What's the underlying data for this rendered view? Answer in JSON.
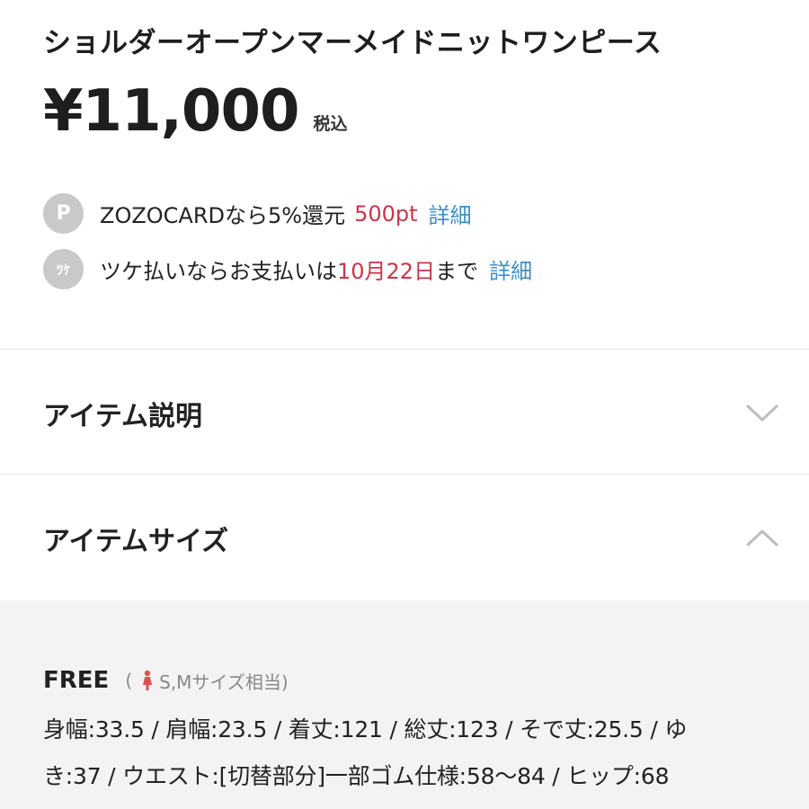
{
  "product": {
    "title": "ショルダーオープンマーメイドニットワンピース",
    "price": "¥11,000",
    "tax_label": "税込"
  },
  "point_info": {
    "badge": "P",
    "text": "ZOZOCARDなら5%還元",
    "points": "500pt",
    "link": "詳細"
  },
  "deferred_payment": {
    "badge": "ﾂｹ",
    "text_before": "ツケ払いならお支払いは",
    "date": "10月22日",
    "text_after": "まで",
    "link": "詳細"
  },
  "sections": {
    "description": {
      "label": "アイテム説明",
      "state": "collapsed"
    },
    "size": {
      "label": "アイテムサイズ",
      "state": "expanded"
    }
  },
  "size_info": {
    "size_name": "FREE",
    "paren_open": "(",
    "equivalent": "S,Mサイズ相当)",
    "line1": "身幅:33.5 / 肩幅:23.5 / 着丈:121 / 総丈:123 / そで丈:25.5 / ゆ",
    "line2": "き:37 / ウエスト:[切替部分]一部ゴム仕様:58～84 / ヒップ:68"
  },
  "colors": {
    "accent_red": "#c8364a",
    "link_blue": "#3d8fc4",
    "badge_gray": "#c9c9c9",
    "panel_bg": "#f3f3f3"
  },
  "icons": {
    "point_badge": "point-icon",
    "tsuke_badge": "tsuke-icon",
    "description_chevron": "chevron-down-icon",
    "size_chevron": "chevron-up-icon",
    "person": "woman-icon"
  }
}
